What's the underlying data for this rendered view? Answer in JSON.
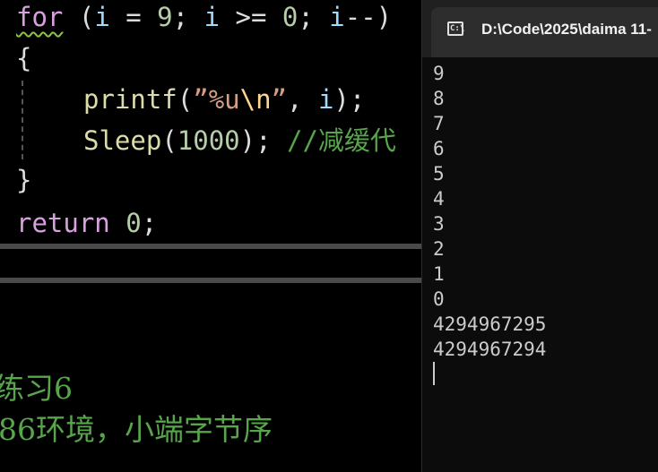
{
  "editor": {
    "lines": {
      "for_kw": "for",
      "for_rest_open": " (",
      "for_i1": "i",
      "for_eq": " = ",
      "for_9": "9",
      "for_semi1": "; ",
      "for_i2": "i",
      "for_ge": " >= ",
      "for_0": "0",
      "for_semi2": "; ",
      "for_i3": "i",
      "for_dec": "--)",
      "brace_open": "{",
      "printf_fn": "printf",
      "printf_paren": "(",
      "printf_str_a": "”%u",
      "printf_esc": "\\n",
      "printf_str_b": "”",
      "printf_comma": ", ",
      "printf_i": "i",
      "printf_end": ");",
      "sleep_fn": "Sleep",
      "sleep_paren": "(",
      "sleep_num": "1000",
      "sleep_end": "); ",
      "sleep_cmt": "//减缓代",
      "brace_close": "}",
      "return_kw": "return",
      "return_space": " ",
      "return_0": "0",
      "return_semi": ";"
    },
    "comments": [
      "练习6",
      "86环境，小端字节序"
    ]
  },
  "console": {
    "tab_icon_label": "C:\\",
    "tab_title": "D:\\Code\\2025\\daima 11-",
    "output": [
      "9",
      "8",
      "7",
      "6",
      "5",
      "4",
      "3",
      "2",
      "1",
      "0",
      "4294967295",
      "4294967294"
    ]
  },
  "colors": {
    "keyword": "#d8a0df",
    "variable": "#9cdcfe",
    "number": "#b5cea8",
    "function": "#dcdcaa",
    "string": "#d69d85",
    "comment": "#57a64a",
    "console_bg": "#0c0c0c",
    "titlebar_bg": "#202020"
  }
}
